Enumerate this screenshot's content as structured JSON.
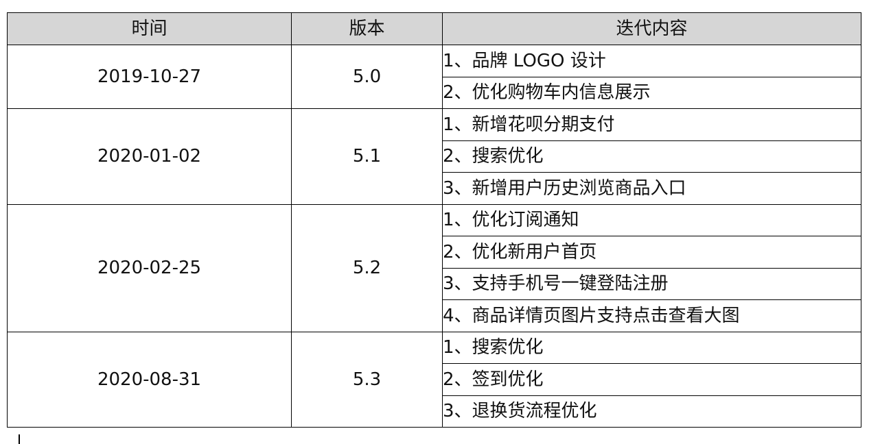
{
  "table": {
    "headers": {
      "time": "时间",
      "version": "版本",
      "content": "迭代内容"
    },
    "releases": [
      {
        "date": "2019-10-27",
        "version": "5.0",
        "items": [
          "1、品牌 LOGO 设计",
          "2、优化购物车内信息展示"
        ]
      },
      {
        "date": "2020-01-02",
        "version": "5.1",
        "items": [
          "1、新增花呗分期支付",
          "2、搜索优化",
          "3、新增用户历史浏览商品入口"
        ]
      },
      {
        "date": "2020-02-25",
        "version": "5.2",
        "items": [
          "1、优化订阅通知",
          "2、优化新用户首页",
          "3、支持手机号一键登陆注册",
          "4、商品详情页图片支持点击查看大图"
        ]
      },
      {
        "date": "2020-08-31",
        "version": "5.3",
        "items": [
          "1、搜索优化",
          "2、签到优化",
          "3、退换货流程优化"
        ]
      }
    ]
  }
}
